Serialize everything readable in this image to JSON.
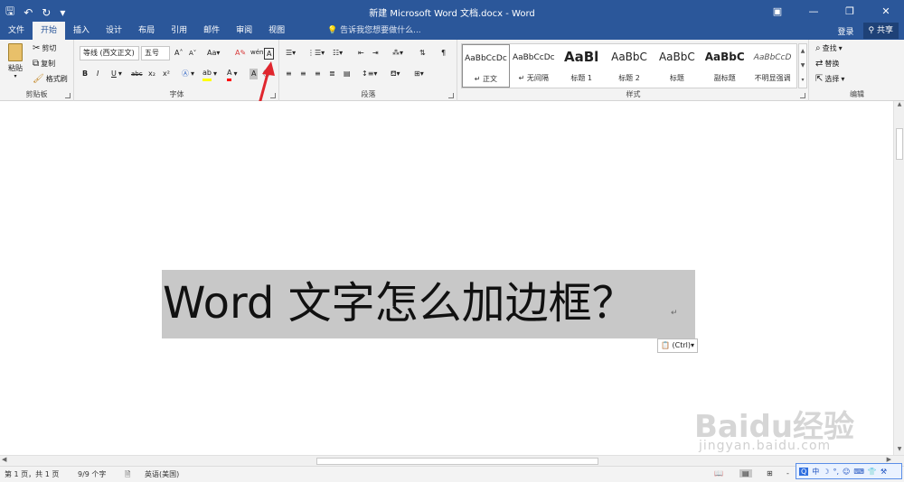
{
  "titlebar": {
    "title": "新建 Microsoft Word 文档.docx - Word",
    "qat": {
      "save_icon": "floppy-icon",
      "undo_icon": "undo-icon",
      "redo_icon": "redo-icon",
      "customize": "▾"
    },
    "controls": {
      "ribbon_display": "▣",
      "minimize": "—",
      "restore": "❐",
      "close": "✕"
    }
  },
  "tabs": {
    "items": [
      "文件",
      "开始",
      "插入",
      "设计",
      "布局",
      "引用",
      "邮件",
      "审阅",
      "视图"
    ],
    "active": "开始",
    "tell_me": "告诉我您想要做什么...",
    "signin": "登录",
    "share": "共享"
  },
  "clipboard": {
    "paste": "粘贴",
    "cut": "剪切",
    "copy": "复制",
    "format_painter": "格式刷",
    "label": "剪贴板"
  },
  "font": {
    "font_name": "等线 (西文正文)",
    "font_size": "五号",
    "label": "字体"
  },
  "paragraph": {
    "label": "段落"
  },
  "styles": {
    "label": "样式",
    "items": [
      {
        "sample": "AaBbCcDc",
        "name": "↵ 正文"
      },
      {
        "sample": "AaBbCcDc",
        "name": "↵ 无间隔"
      },
      {
        "sample": "AaBl",
        "name": "标题 1"
      },
      {
        "sample": "AaBbC",
        "name": "标题 2"
      },
      {
        "sample": "AaBbC",
        "name": "标题"
      },
      {
        "sample": "AaBbC",
        "name": "副标题"
      },
      {
        "sample": "AaBbCcD",
        "name": "不明显强调"
      }
    ]
  },
  "editing": {
    "find": "查找",
    "replace": "替换",
    "select": "选择",
    "label": "编辑"
  },
  "document": {
    "text": "Word 文字怎么加边框？",
    "paragraph_mark": "↵",
    "paste_options": "(Ctrl)"
  },
  "status": {
    "page": "第 1 页，共 1 页",
    "words": "9/9 个字",
    "language": "英语(美国)",
    "zoom": "-"
  },
  "ime": {
    "label": "中"
  },
  "watermark": {
    "brand": "Baidu经验",
    "url": "jingyan.baidu.com"
  },
  "colors": {
    "word_blue": "#2b579a",
    "selection_gray": "#c8c8c8",
    "highlight_yellow": "#ffff00",
    "font_red": "#ff0000",
    "arrow_red": "#e0262e"
  }
}
